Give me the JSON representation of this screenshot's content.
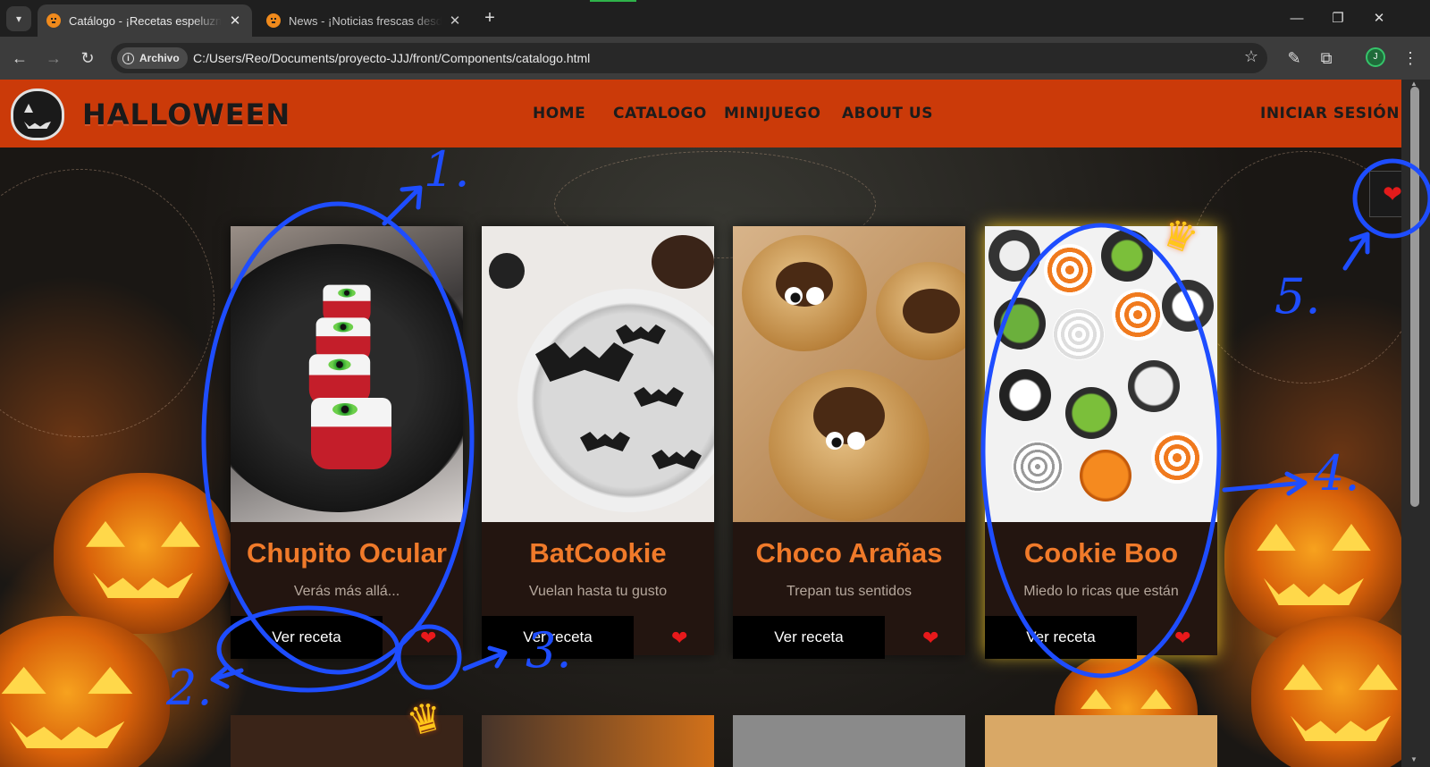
{
  "browser": {
    "tabs": [
      {
        "title": "Catálogo - ¡Recetas espeluznantes!",
        "active": true
      },
      {
        "title": "News - ¡Noticias frescas desde el",
        "active": false
      }
    ],
    "address": {
      "security_chip": "Archivo",
      "url": "C:/Users/Reo/Documents/proyecto-JJJ/front/Components/catalogo.html"
    },
    "profile_initial": "J",
    "icons": [
      "tab-search-icon",
      "close-icon",
      "plus-icon",
      "minimize-icon",
      "restore-icon",
      "back-icon",
      "forward-icon",
      "reload-icon",
      "star-icon",
      "eyedropper-icon",
      "extensions-icon",
      "kebab-menu-icon"
    ]
  },
  "site": {
    "logo_text": "HALLOWEEN",
    "nav": [
      "HOME",
      "CATALOGO",
      "MINIJUEGO",
      "ABOUT US"
    ],
    "login": "INICIAR SESIÓN",
    "favorites_button_icon": "heart-icon",
    "cards": [
      {
        "title": "Chupito Ocular",
        "subtitle": "Verás más allá...",
        "button": "Ver receta",
        "featured": false
      },
      {
        "title": "BatCookie",
        "subtitle": "Vuelan hasta tu gusto",
        "button": "Ver receta",
        "featured": false
      },
      {
        "title": "Choco Arañas",
        "subtitle": "Trepan tus sentidos",
        "button": "Ver receta",
        "featured": false
      },
      {
        "title": "Cookie Boo",
        "subtitle": "Miedo lo ricas que están",
        "button": "Ver receta",
        "featured": true
      }
    ]
  },
  "annotations": {
    "labels": [
      "1.",
      "2.",
      "3.",
      "4.",
      "5."
    ],
    "color": "#1e4dff"
  },
  "colors": {
    "nav_bg": "#cb3a09",
    "title_orange": "#f07a2a",
    "heart_red": "#e8191b",
    "crown_gold": "#ffc61a"
  }
}
